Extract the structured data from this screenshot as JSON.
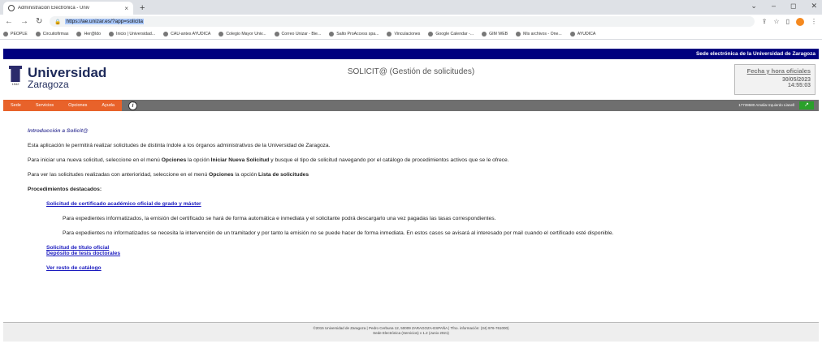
{
  "browser": {
    "tab_title": "Administración Electrónica - Univ",
    "url": "https://ae.unizar.es/?app=solicita",
    "new_tab": "+",
    "tab_close": "×",
    "window_controls": [
      "⌄",
      "–",
      "◻",
      "✕"
    ]
  },
  "bookmarks": [
    "PEOPLE",
    "Circuitofirmas",
    "Her@ldo",
    "Inicio | Universidad...",
    "CAU-antes AYUDICA",
    "Colegio Mayor Univ...",
    "Correo Unizar - Bie...",
    "Salto ProAccess spa...",
    "Vinculaciones",
    "Google Calendar -...",
    "GIM WEB",
    "Mis archivos - One...",
    "AYUDICA"
  ],
  "site": {
    "topbar": "Sede electrónica de la Universidad de Zaragoza",
    "univ": "Universidad",
    "city": "Zaragoza",
    "year": "1542",
    "app_title": "SOLICIT@ (Gestión de solicitudes)",
    "date_label": "Fecha y hora oficiales",
    "date": "30/05/2023",
    "time": "14:55:03"
  },
  "menu": {
    "items": [
      "Sede",
      "Servicios",
      "Opciones",
      "Ayuda"
    ],
    "user": "17739580 Amalia Izquierdo Llanell",
    "exit_icon": "↗"
  },
  "content": {
    "intro": "Introducción a Solicit@",
    "p1": "Esta aplicación le permitirá realizar solicitudes de distinta índole a los órganos administrativos de la Universidad de Zaragoza.",
    "p2a": "Para iniciar una nueva solicitud, seleccione en el menú ",
    "p2b": "Opciones",
    "p2c": " la opción ",
    "p2d": "Iniciar Nueva Solicitud",
    "p2e": " y busque el tipo de solicitud navegando por el catálogo de procedimientos activos que se le ofrece.",
    "p3a": "Para ver las solicitudes realizadas con anterioridad, seleccione en el menú ",
    "p3b": "Opciones",
    "p3c": " la opción ",
    "p3d": "Lista de solicitudes",
    "featured": "Procedimientos destacados:",
    "link1": "Solicitud de certificado académico oficial de grado y máster",
    "d1": "Para expedientes informatizados, la emisión del certificado se hará de forma automática e inmediata y el solicitante podrá descargarlo una vez pagadas las tasas correspondientes.",
    "d2": "Para expedientes no informatizados se necesita la intervención de un tramitador y por tanto la emisión no se puede hacer de forma inmediata. En estos casos se avisará al interesado por mail cuando el certificado esté disponible.",
    "link2": "Solicitud de título oficial",
    "link3": "Depósito de tesis doctorales",
    "link4": "Ver resto de catálogo"
  },
  "footer": {
    "l1": "©2015 Universidad de Zaragoza | Pedro Cerbuna 12, 50009 ZARAGOZA-ESPAÑA | Tfno. información: (34) 976-761000)",
    "l2": "Sede Electrónica (Servicios) v 1.2 (Junio 2021)"
  }
}
